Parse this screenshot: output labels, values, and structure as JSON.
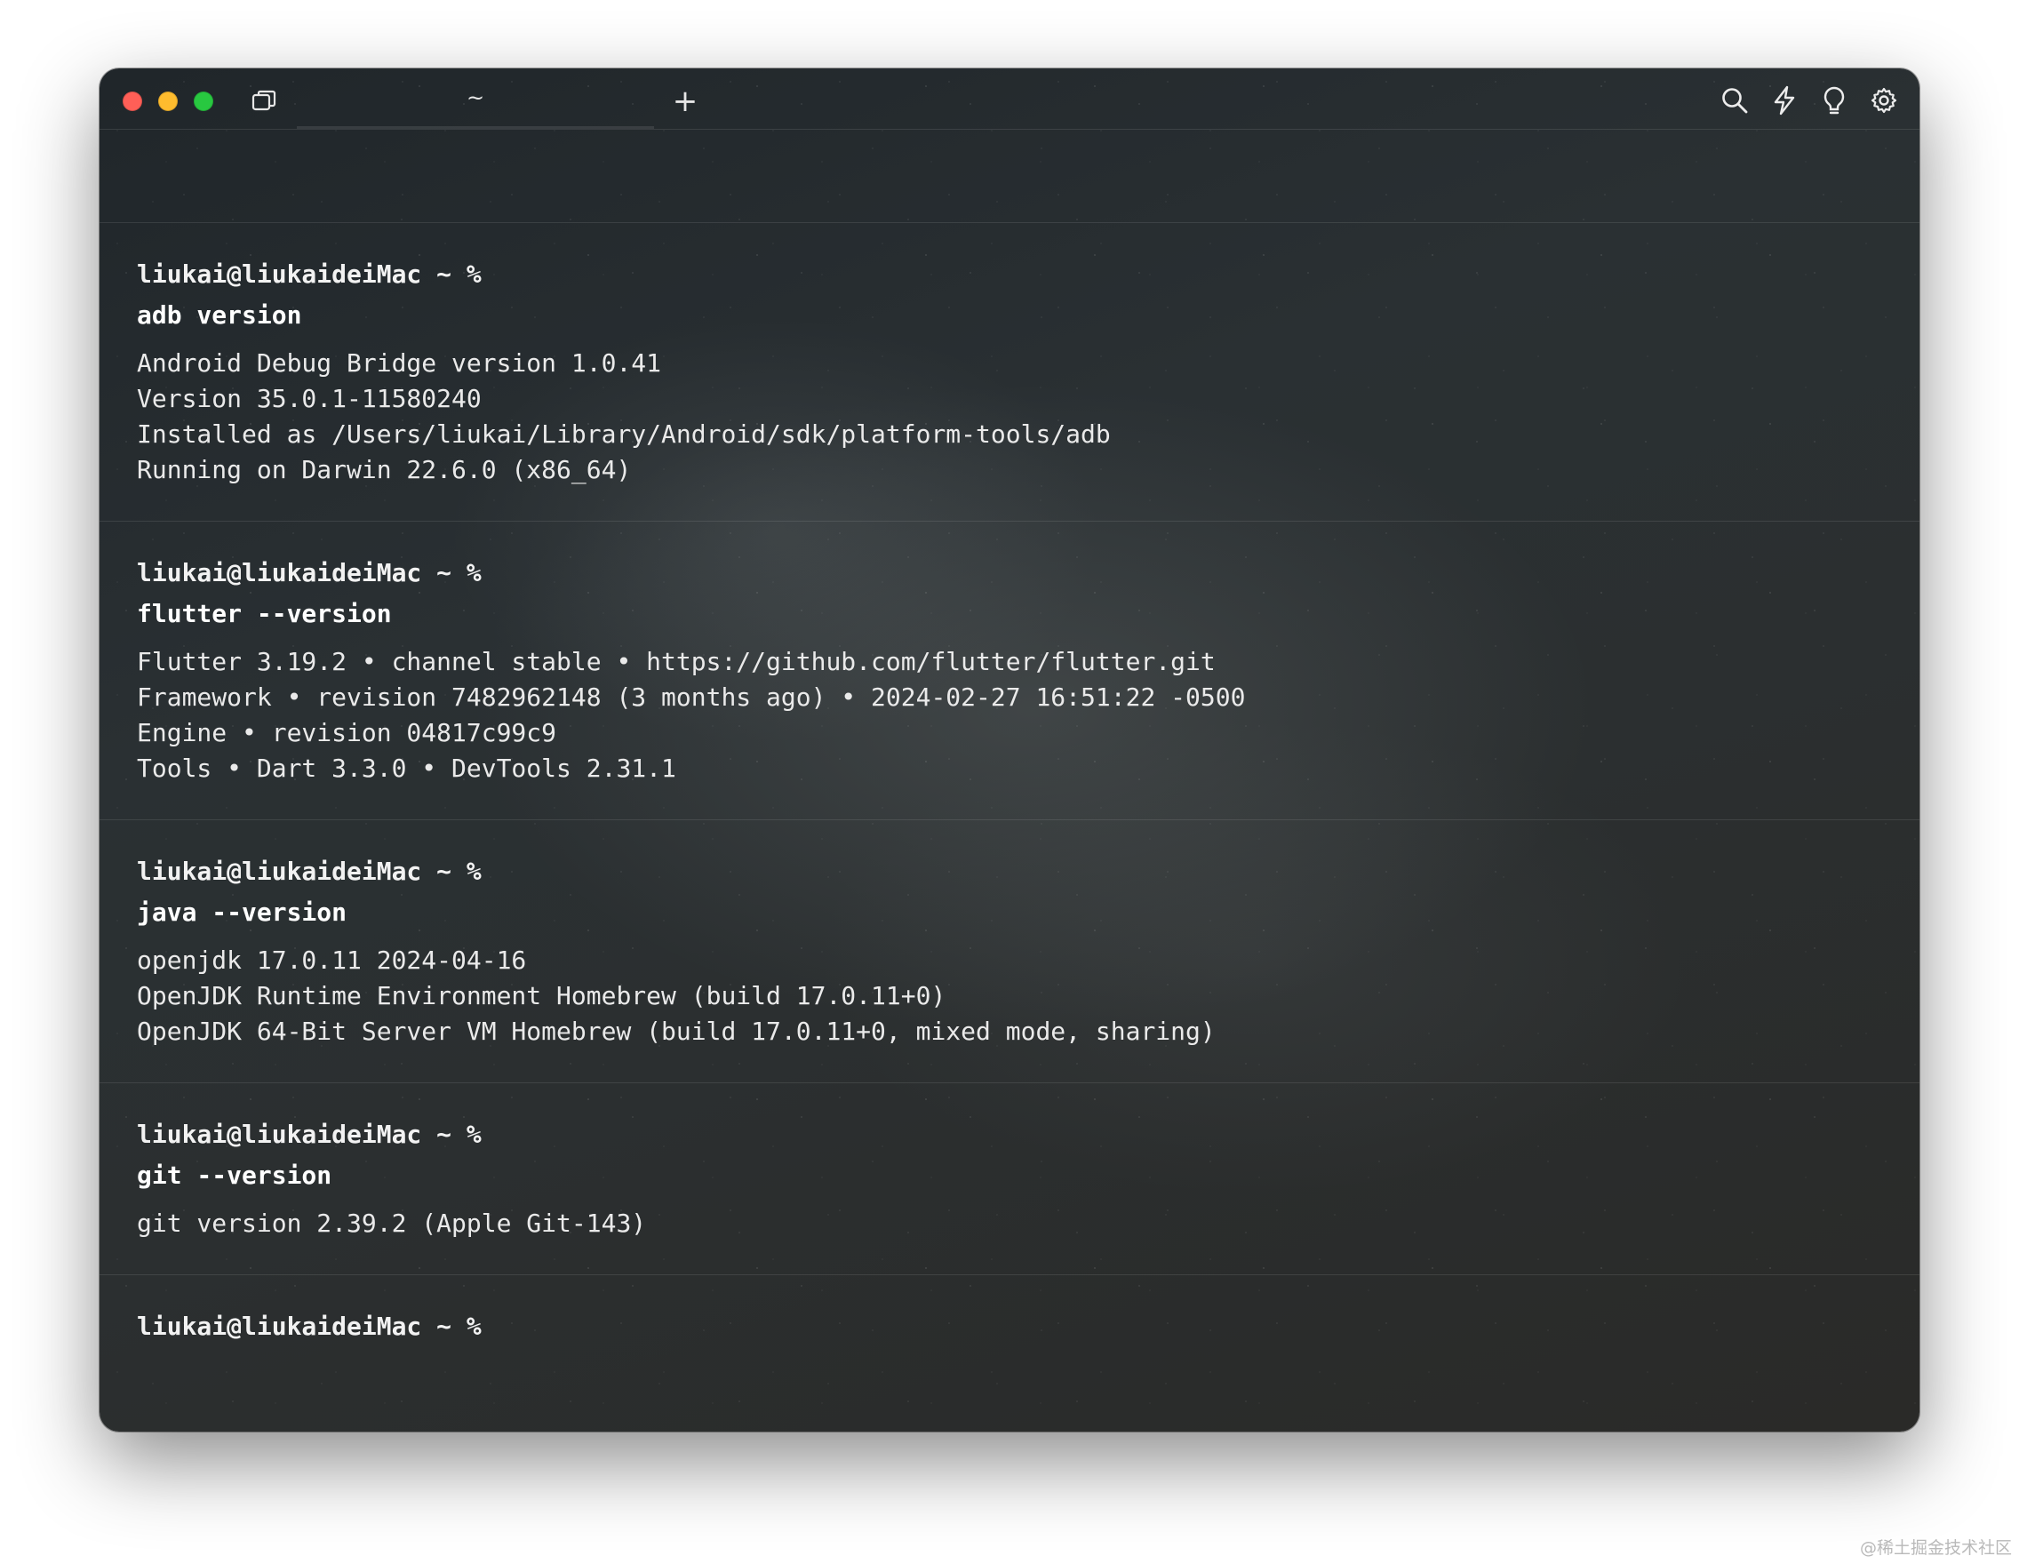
{
  "window": {
    "tab_title": "~",
    "new_tab_label": "+"
  },
  "toolbar": {
    "icons": [
      "search-icon",
      "lightning-icon",
      "lightbulb-icon",
      "settings-gear-icon"
    ]
  },
  "terminal": {
    "blocks": [
      {
        "prompt": "liukai@liukaideiMac ~ %",
        "command": "adb version",
        "output": [
          "Android Debug Bridge version 1.0.41",
          "Version 35.0.1-11580240",
          "Installed as /Users/liukai/Library/Android/sdk/platform-tools/adb",
          "Running on Darwin 22.6.0 (x86_64)"
        ]
      },
      {
        "prompt": "liukai@liukaideiMac ~ %",
        "command": "flutter --version",
        "output": [
          "Flutter 3.19.2 • channel stable • https://github.com/flutter/flutter.git",
          "Framework • revision 7482962148 (3 months ago) • 2024-02-27 16:51:22 -0500",
          "Engine • revision 04817c99c9",
          "Tools • Dart 3.3.0 • DevTools 2.31.1"
        ]
      },
      {
        "prompt": "liukai@liukaideiMac ~ %",
        "command": "java --version",
        "output": [
          "openjdk 17.0.11 2024-04-16",
          "OpenJDK Runtime Environment Homebrew (build 17.0.11+0)",
          "OpenJDK 64-Bit Server VM Homebrew (build 17.0.11+0, mixed mode, sharing)"
        ]
      },
      {
        "prompt": "liukai@liukaideiMac ~ %",
        "command": "git --version",
        "output": [
          "git version 2.39.2 (Apple Git-143)"
        ]
      }
    ],
    "current_prompt": "liukai@liukaideiMac ~ %"
  },
  "watermark": "@稀土掘金技术社区"
}
